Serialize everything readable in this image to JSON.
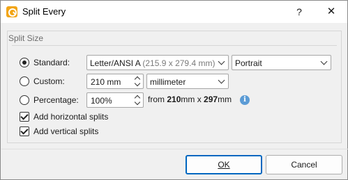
{
  "window": {
    "title": "Split Every"
  },
  "titlebar": {
    "help_glyph": "?",
    "close_glyph": "✕",
    "icon": "app-logo-icon"
  },
  "group": {
    "title": "Split Size"
  },
  "rows": {
    "standard": {
      "label": "Standard:",
      "selected": true,
      "paper_size_main": "Letter/ANSI A",
      "paper_size_dim": "(215.9 x 279.4 mm)",
      "orientation": "Portrait"
    },
    "custom": {
      "label": "Custom:",
      "selected": false,
      "size_value": "210 mm",
      "unit": "millimeter"
    },
    "percentage": {
      "label": "Percentage:",
      "selected": false,
      "value": "100%",
      "info_from": "from ",
      "info_width": "210",
      "info_mid": "mm x ",
      "info_height": "297",
      "info_unit": "mm",
      "info_icon": "info-icon"
    }
  },
  "options": {
    "horizontal": {
      "label": "Add horizontal splits",
      "checked": true
    },
    "vertical": {
      "label": "Add vertical splits",
      "checked": true
    }
  },
  "buttons": {
    "ok": "OK",
    "cancel": "Cancel"
  }
}
